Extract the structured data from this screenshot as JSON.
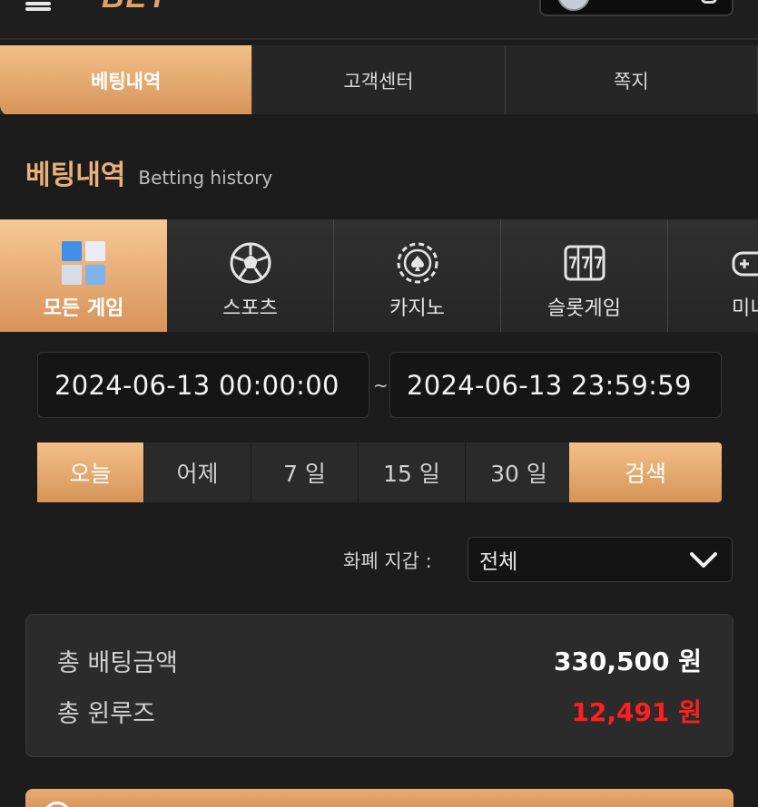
{
  "header": {
    "logo_text": "BET",
    "icons": {
      "menu": "hamburger-icon",
      "avatar": "avatar-icon",
      "chip": "wallet-icon"
    }
  },
  "main_tabs": [
    {
      "label": "베팅내역",
      "active": true
    },
    {
      "label": "고객센터",
      "active": false
    },
    {
      "label": "쪽지",
      "active": false
    }
  ],
  "section": {
    "title": "베팅내역",
    "subtitle": "Betting history"
  },
  "categories": [
    {
      "label": "모든 게임",
      "icon": "all-games-icon",
      "active": true
    },
    {
      "label": "스포츠",
      "icon": "soccer-ball-icon",
      "active": false
    },
    {
      "label": "카지노",
      "icon": "casino-chip-icon",
      "active": false
    },
    {
      "label": "슬롯게임",
      "icon": "slot-machine-icon",
      "active": false
    },
    {
      "label": "미니",
      "icon": "gamepad-icon",
      "active": false
    }
  ],
  "date_range": {
    "from": "2024-06-13 00:00:00",
    "separator": "~",
    "to": "2024-06-13 23:59:59"
  },
  "periods": [
    {
      "label": "오늘",
      "active": true
    },
    {
      "label": "어제",
      "active": false
    },
    {
      "label": "7 일",
      "active": false
    },
    {
      "label": "15 일",
      "active": false
    },
    {
      "label": "30 일",
      "active": false
    }
  ],
  "search_label": "검색",
  "currency": {
    "label": "화폐 지갑 :",
    "selected": "전체",
    "icon": "chevron-down-icon"
  },
  "summary": {
    "total_bet_label": "총 배팅금액",
    "total_bet_value": "330,500 원",
    "total_winloss_label": "총 윈루즈",
    "total_winloss_value": "12,491 원"
  },
  "colors": {
    "accent": "#e0a466",
    "accent_light": "#f3c089",
    "background": "#1c1c1c",
    "negative": "#ff1f1f"
  }
}
